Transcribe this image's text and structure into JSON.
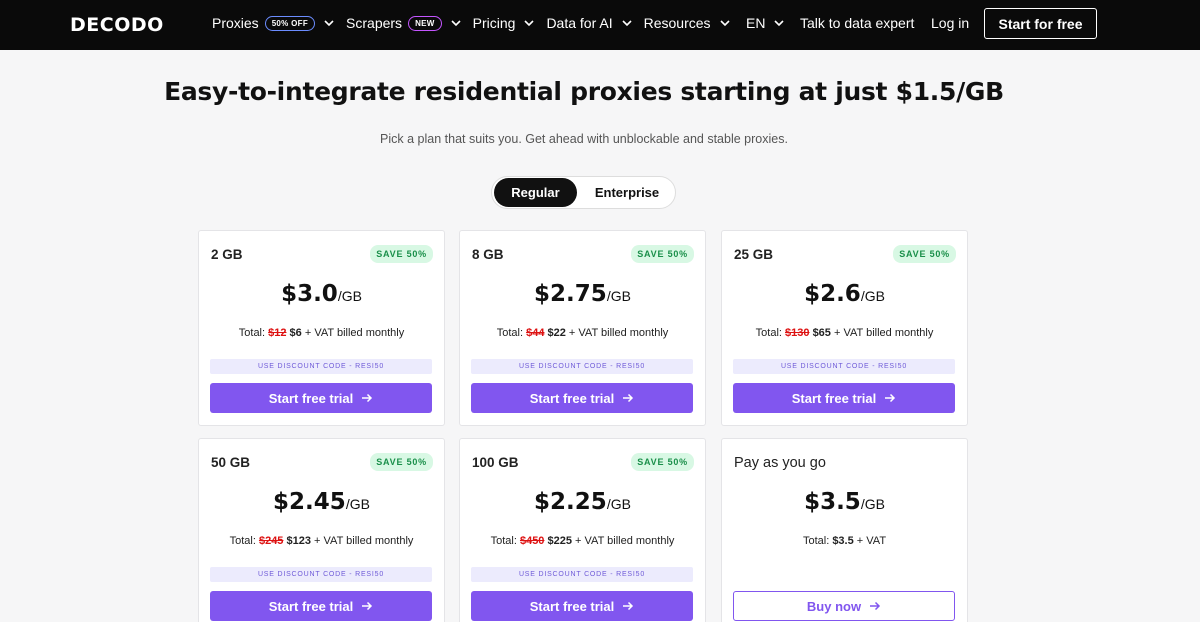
{
  "nav": {
    "logo": "DECODO",
    "menu": [
      {
        "label": "Proxies",
        "badge": "50% OFF",
        "badge_type": "off"
      },
      {
        "label": "Scrapers",
        "badge": "NEW",
        "badge_type": "new"
      },
      {
        "label": "Pricing",
        "badge": null
      },
      {
        "label": "Data for AI",
        "badge": null
      },
      {
        "label": "Resources",
        "badge": null
      }
    ],
    "lang": "EN",
    "talk": "Talk to data expert",
    "login": "Log in",
    "start": "Start for free"
  },
  "hero": {
    "title": "Easy-to-integrate residential proxies starting at just $1.5/GB",
    "subtitle": "Pick a plan that suits you. Get ahead with unblockable and stable proxies."
  },
  "toggle": {
    "regular": "Regular",
    "enterprise": "Enterprise",
    "selected": "Regular"
  },
  "cards": [
    {
      "plan": "2 GB",
      "save": "SAVE 50%",
      "price": "$3.0",
      "unit": "/GB",
      "total_prefix": "Total:",
      "old": "$12",
      "new": "$6",
      "total_suffix": "+ VAT billed monthly",
      "code": "USE DISCOUNT CODE - RESI50",
      "cta": "Start free trial"
    },
    {
      "plan": "8 GB",
      "save": "SAVE 50%",
      "price": "$2.75",
      "unit": "/GB",
      "total_prefix": "Total:",
      "old": "$44",
      "new": "$22",
      "total_suffix": "+ VAT billed monthly",
      "code": "USE DISCOUNT CODE - RESI50",
      "cta": "Start free trial"
    },
    {
      "plan": "25 GB",
      "save": "SAVE 50%",
      "price": "$2.6",
      "unit": "/GB",
      "total_prefix": "Total:",
      "old": "$130",
      "new": "$65",
      "total_suffix": "+ VAT billed monthly",
      "code": "USE DISCOUNT CODE - RESI50",
      "cta": "Start free trial"
    },
    {
      "plan": "50 GB",
      "save": "SAVE 50%",
      "price": "$2.45",
      "unit": "/GB",
      "total_prefix": "Total:",
      "old": "$245",
      "new": "$123",
      "total_suffix": "+ VAT billed monthly",
      "code": "USE DISCOUNT CODE - RESI50",
      "cta": "Start free trial"
    },
    {
      "plan": "100 GB",
      "save": "SAVE 50%",
      "price": "$2.25",
      "unit": "/GB",
      "total_prefix": "Total:",
      "old": "$450",
      "new": "$225",
      "total_suffix": "+ VAT billed monthly",
      "code": "USE DISCOUNT CODE - RESI50",
      "cta": "Start free trial"
    },
    {
      "plan": "Pay as you go",
      "price": "$3.5",
      "unit": "/GB",
      "total_prefix": "Total:",
      "new": "$3.5",
      "total_suffix": "+ VAT",
      "cta": "Buy now"
    }
  ],
  "colors": {
    "accent": "#8156ef",
    "save_bg": "#d8f8e4",
    "save_text": "#1a8f4a",
    "strike": "#dd1111",
    "nav_bg": "#0a0a0a"
  },
  "icons": {
    "chevron": "chevron-down-icon",
    "arrow": "arrow-right-icon"
  }
}
